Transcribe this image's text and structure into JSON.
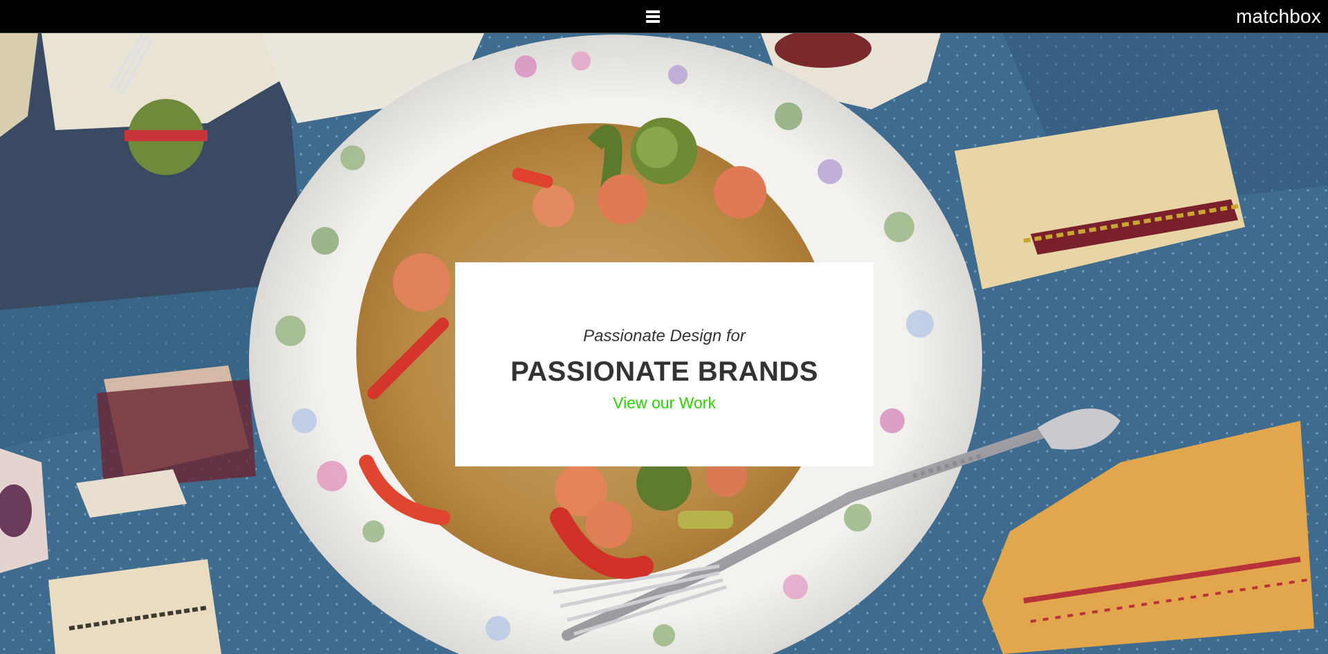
{
  "header": {
    "logo_text": "matchbox",
    "menu_icon": "hamburger-menu-icon",
    "background_color": "#000000"
  },
  "hero": {
    "background_image": "overhead photo of a floral plate with quinoa, shrimp and vegetables beside a silver fork on a blue coffee-cup tablecloth"
  },
  "card": {
    "tagline": "Passionate Design for",
    "headline": "PASSIONATE BRANDS",
    "cta_label": "View our Work",
    "cta_color": "#2ad400"
  }
}
